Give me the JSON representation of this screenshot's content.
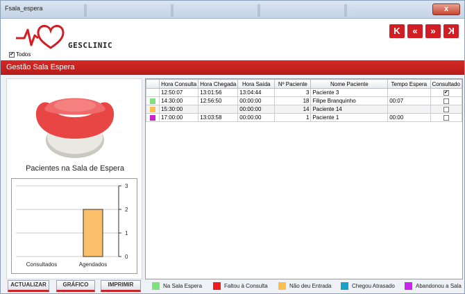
{
  "window": {
    "title": "Fsala_espera",
    "close_label": "x"
  },
  "header": {
    "brand": "GESCLINIC",
    "todos_label": "Todos",
    "todos_checked": true,
    "nav": [
      "K",
      "«",
      "»",
      "K"
    ]
  },
  "section_title": "Gestão Sala Espera",
  "left_panel": {
    "chart_title": "Pacientes na Sala de Espera"
  },
  "chart_data": {
    "type": "bar",
    "categories": [
      "Consultados",
      "Agendados"
    ],
    "values": [
      0,
      2
    ],
    "ylim": [
      0,
      3
    ],
    "yticks": [
      "0",
      "1",
      "2",
      "3"
    ],
    "bar_color": "#fbbf6a",
    "axis_side": "right",
    "grid": true
  },
  "table": {
    "columns": [
      "",
      "Hora Consulta",
      "Hora Chegada",
      "Hora Saída",
      "Nº Paciente",
      "Nome Paciente",
      "Tempo Espera",
      "Consultado"
    ],
    "rows": [
      {
        "color": "",
        "hora_consulta": "12:50:07",
        "hora_chegada": "13:01:56",
        "hora_saida": "13:04:44",
        "num": "3",
        "nome": "Paciente 3",
        "tempo": "",
        "consultado": true
      },
      {
        "color": "#7fe07f",
        "hora_consulta": "14:30:00",
        "hora_chegada": "12:56:50",
        "hora_saida": "00:00:00",
        "num": "18",
        "nome": "Filipe Branquinho",
        "tempo": "00:07",
        "consultado": false
      },
      {
        "color": "#fbbf4f",
        "hora_consulta": "15:30:00",
        "hora_chegada": "",
        "hora_saida": "00:00:00",
        "num": "14",
        "nome": "Paciente 14",
        "tempo": "",
        "consultado": false
      },
      {
        "color": "#cc22cc",
        "hora_consulta": "17:00:00",
        "hora_chegada": "13:03:58",
        "hora_saida": "00:00:00",
        "num": "1",
        "nome": "Paciente 1",
        "tempo": "00:00",
        "consultado": false
      }
    ]
  },
  "buttons": {
    "atualizar": "ACTUALIZAR",
    "grafico": "GRÁFICO",
    "imprimir": "IMPRIMIR"
  },
  "legend": [
    {
      "label": "Na Sala Espera",
      "color": "#7fe07f"
    },
    {
      "label": "Faltou à Consulta",
      "color": "#ee1c1c"
    },
    {
      "label": "Não deu Entrada",
      "color": "#fbbf4f"
    },
    {
      "label": "Chegou Atrasado",
      "color": "#1aa3c8"
    },
    {
      "label": "Abandonou a Sala",
      "color": "#cc22ee"
    }
  ]
}
